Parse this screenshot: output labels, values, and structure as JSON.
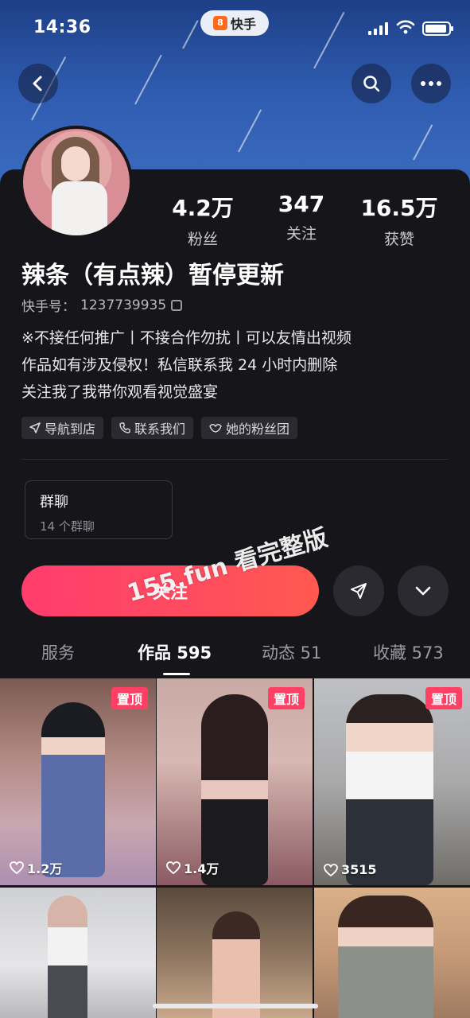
{
  "status_bar": {
    "time": "14:36",
    "app_name": "快手",
    "app_logo": "8"
  },
  "profile": {
    "name": "辣条（有点辣）暂停更新",
    "kuaishou_id_label": "快手号：",
    "kuaishou_id": "1237739935",
    "bio_lines": [
      "※不接任何推广丨不接合作勿扰丨可以友情出视频",
      "作品如有涉及侵权！私信联系我 24 小时内删除",
      "关注我了我带你观看视觉盛宴"
    ],
    "stats": [
      {
        "num": "4.2万",
        "label": "粉丝"
      },
      {
        "num": "347",
        "label": "关注"
      },
      {
        "num": "16.5万",
        "label": "获赞"
      }
    ],
    "chips": [
      {
        "icon": "navigation-icon",
        "label": "导航到店"
      },
      {
        "icon": "phone-icon",
        "label": "联系我们"
      },
      {
        "icon": "fan-group-icon",
        "label": "她的粉丝团"
      }
    ]
  },
  "group_chat": {
    "title": "群聊",
    "subtitle": "14 个群聊"
  },
  "actions": {
    "follow_label": "关注"
  },
  "watermark": "155.fun 看完整版",
  "tabs": [
    {
      "label": "服务",
      "active": false
    },
    {
      "label": "作品 595",
      "active": true
    },
    {
      "label": "动态 51",
      "active": false
    },
    {
      "label": "收藏 573",
      "active": false
    }
  ],
  "works": [
    {
      "pinned": true,
      "pin_label": "置顶",
      "likes": "1.2万"
    },
    {
      "pinned": true,
      "pin_label": "置顶",
      "likes": "1.4万"
    },
    {
      "pinned": true,
      "pin_label": "置顶",
      "likes": "3515"
    },
    {
      "pinned": false,
      "likes": ""
    },
    {
      "pinned": false,
      "likes": ""
    },
    {
      "pinned": false,
      "likes": ""
    }
  ],
  "colors": {
    "accent": "#ff4a62",
    "background": "#16161a",
    "chip_bg": "#2a2a30"
  }
}
